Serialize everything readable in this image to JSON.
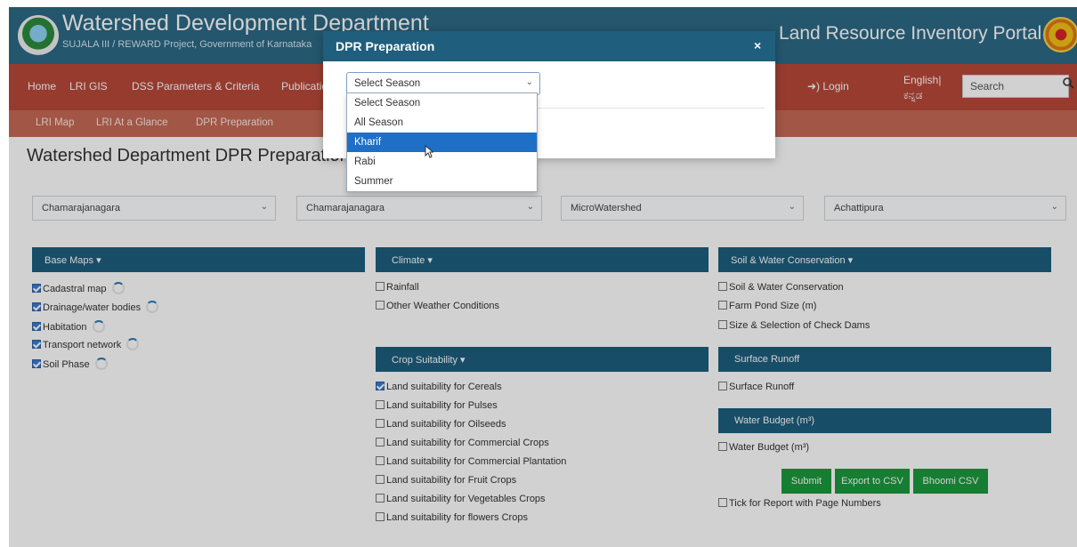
{
  "header": {
    "title": "Watershed Development Department",
    "subtitle": "SUJALA III / REWARD Project, Government of Karnataka",
    "portal_title": "Land Resource Inventory Portal"
  },
  "nav_primary": {
    "items": [
      "Home",
      "LRI GIS",
      "DSS Parameters & Criteria",
      "Publications"
    ],
    "login": "➜) Login",
    "lang_en": "English|",
    "lang_kn": "ಕನ್ನಡ",
    "search_placeholder": "Search"
  },
  "nav_secondary": {
    "items": [
      "LRI Map",
      "LRI At a Glance",
      "DPR Preparation"
    ]
  },
  "page": {
    "title": "Watershed Department DPR Preparation",
    "selects": [
      "Chamarajanagara",
      "Chamarajanagara",
      "MicroWatershed",
      "Achattipura"
    ]
  },
  "sections": {
    "base_maps": {
      "header": "Base Maps ▾",
      "items": [
        "Cadastral map",
        "Drainage/water bodies",
        "Habitation",
        "Transport network",
        "Soil Phase"
      ]
    },
    "climate": {
      "header": "Climate ▾",
      "items": [
        "Rainfall",
        "Other Weather Conditions"
      ]
    },
    "soil_water": {
      "header": "Soil & Water Conservation ▾",
      "items": [
        "Soil & Water Conservation",
        "Farm Pond Size (m)",
        "Size & Selection of Check Dams"
      ]
    },
    "crop_suitability": {
      "header": "Crop Suitability ▾",
      "items": [
        "Land suitability for Cereals",
        "Land suitability for Pulses",
        "Land suitability for Oilseeds",
        "Land suitability for Commercial Crops",
        "Land suitability for Commercial Plantation",
        "Land suitability for Fruit Crops",
        "Land suitability for Vegetables Crops",
        "Land suitability for flowers Crops"
      ]
    },
    "surface_runoff": {
      "header": "Surface Runoff",
      "items": [
        "Surface Runoff"
      ]
    },
    "water_budget": {
      "header": "Water Budget (m³)",
      "items": [
        "Water Budget (m³)"
      ]
    }
  },
  "buttons": {
    "submit": "Submit",
    "export_csv": "Export to CSV",
    "bhoomi_csv": "Bhoomi CSV"
  },
  "report_checkbox": "Tick for Report with Page Numbers",
  "modal": {
    "title": "DPR Preparation",
    "close": "×",
    "select_value": "Select Season",
    "options": [
      "Select Season",
      "All Season",
      "Kharif",
      "Rabi",
      "Summer"
    ],
    "highlighted": "Kharif"
  },
  "colors": {
    "header_bg": "#2c6a86",
    "nav_bg": "#b9483a",
    "subnav_bg": "#c66a56",
    "section_bg": "#1e5f7e",
    "button_bg": "#1c9a3e",
    "highlight": "#1f6fc7"
  }
}
